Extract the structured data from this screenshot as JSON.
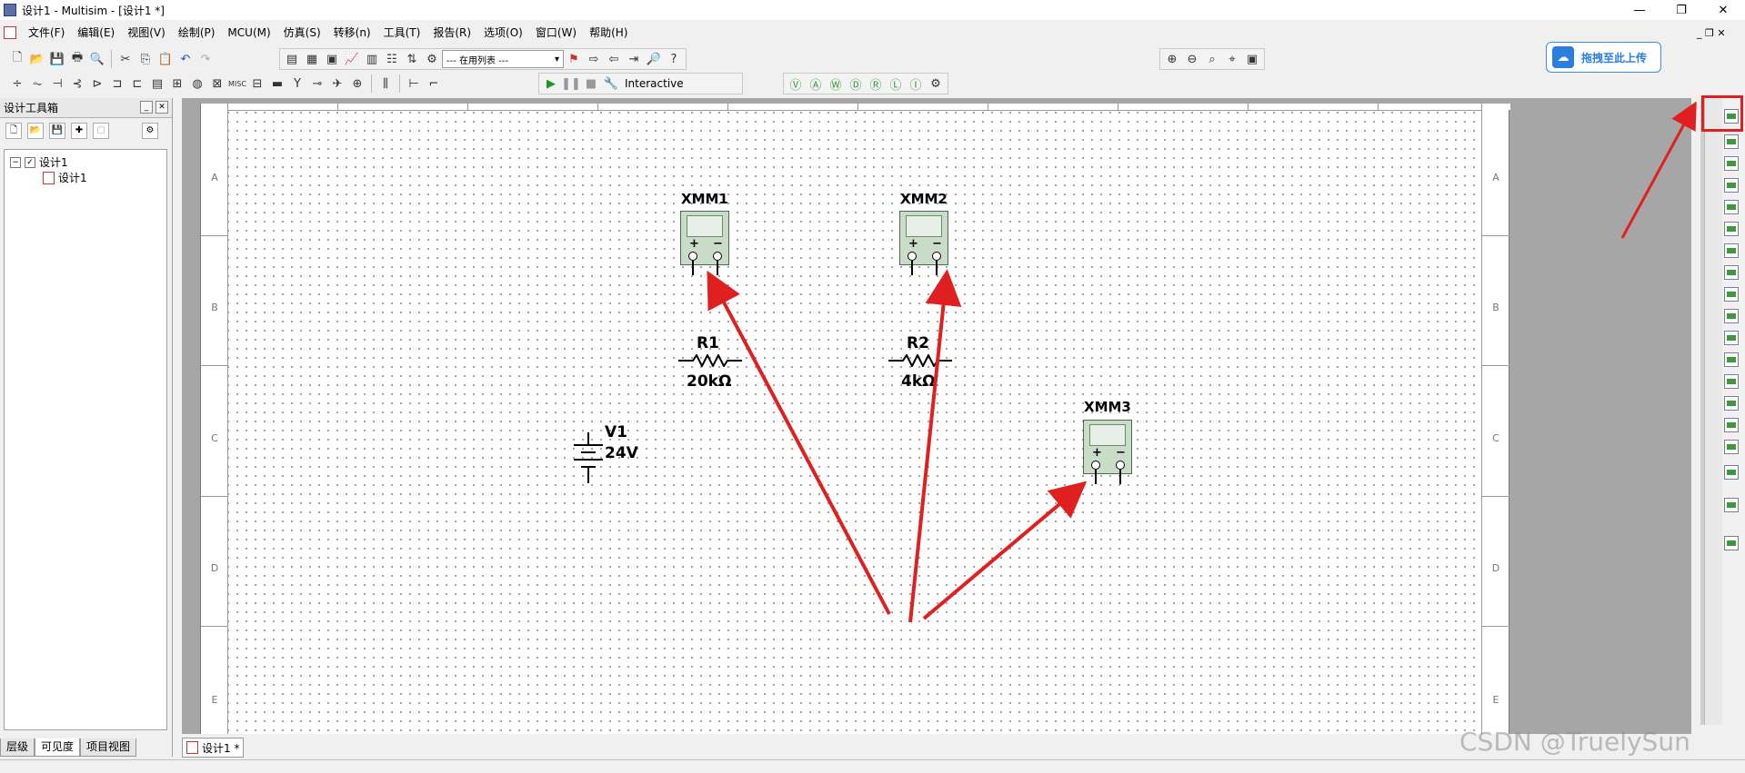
{
  "window": {
    "title": "设计1 - Multisim - [设计1 *]",
    "minimize": "—",
    "restore": "❐",
    "close": "✕"
  },
  "menu": {
    "items": [
      "文件(F)",
      "编辑(E)",
      "视图(V)",
      "绘制(P)",
      "MCU(M)",
      "仿真(S)",
      "转移(n)",
      "工具(T)",
      "报告(R)",
      "选项(O)",
      "窗口(W)",
      "帮助(H)"
    ],
    "mdi_controls": "_ ❐ ✕"
  },
  "toolbar": {
    "in_use_list": "--- 在用列表 ---",
    "simulation_mode": "Interactive",
    "upload_label": "拖拽至此上传"
  },
  "design_toolbox": {
    "title": "设计工具箱",
    "tree_root": "设计1",
    "tree_child": "设计1",
    "tabs": [
      "层级",
      "可见度",
      "项目视图"
    ]
  },
  "sheet": {
    "row_labels": [
      "A",
      "B",
      "C",
      "D",
      "E"
    ]
  },
  "components": {
    "xmm1": {
      "label": "XMM1"
    },
    "xmm2": {
      "label": "XMM2"
    },
    "xmm3": {
      "label": "XMM3"
    },
    "r1": {
      "label": "R1",
      "value": "20kΩ"
    },
    "r2": {
      "label": "R2",
      "value": "4kΩ"
    },
    "v1": {
      "label": "V1",
      "value": "24V"
    }
  },
  "meter_signs": {
    "plus": "+",
    "minus": "−"
  },
  "document_tab": "设计1 *",
  "watermark": "CSDN @TruelySun",
  "colors": {
    "arrow": "#e02020",
    "meter_body": "#c8dcc8",
    "upload_accent": "#2a7ee0"
  }
}
